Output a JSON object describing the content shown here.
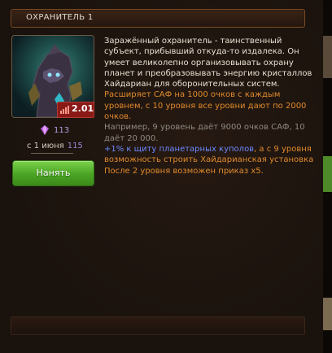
{
  "header": {
    "title": "ОХРАНИТЕЛЬ 1"
  },
  "card": {
    "level": "2.01",
    "price": "113",
    "since_label": "с 1 июня",
    "since_value": "115",
    "hire_label": "Нанять"
  },
  "description": {
    "main": "Заражённый охранитель - таинственный субъект, прибывший откуда-то издалека. Он умеет великолепно организовывать охрану планет и преобразовывать энергию кристаллов Хайдариан для оборонительных систем.",
    "highlight": "Расширяет САФ на 1000 очков с каждым уровнем, с 10 уровня все уровни дают по 2000 очков.",
    "example": "Например, 9 уровень даёт 9000 очков САФ, 10 даёт 20 000.",
    "bonus_prefix": "+1% к щиту планетарных куполов",
    "bonus_suffix": ", а с 9 уровня возможность строить Хайдарианская установка",
    "order": "После 2 уровня возможен приказ x5."
  },
  "colors": {
    "accent_orange": "#e08a2c",
    "button_green": "#4aa424",
    "badge_red": "#8a1a17",
    "gem_purple": "#c066e8"
  },
  "icons": [
    "guardian-portrait",
    "level-bars-icon",
    "gem-icon"
  ]
}
